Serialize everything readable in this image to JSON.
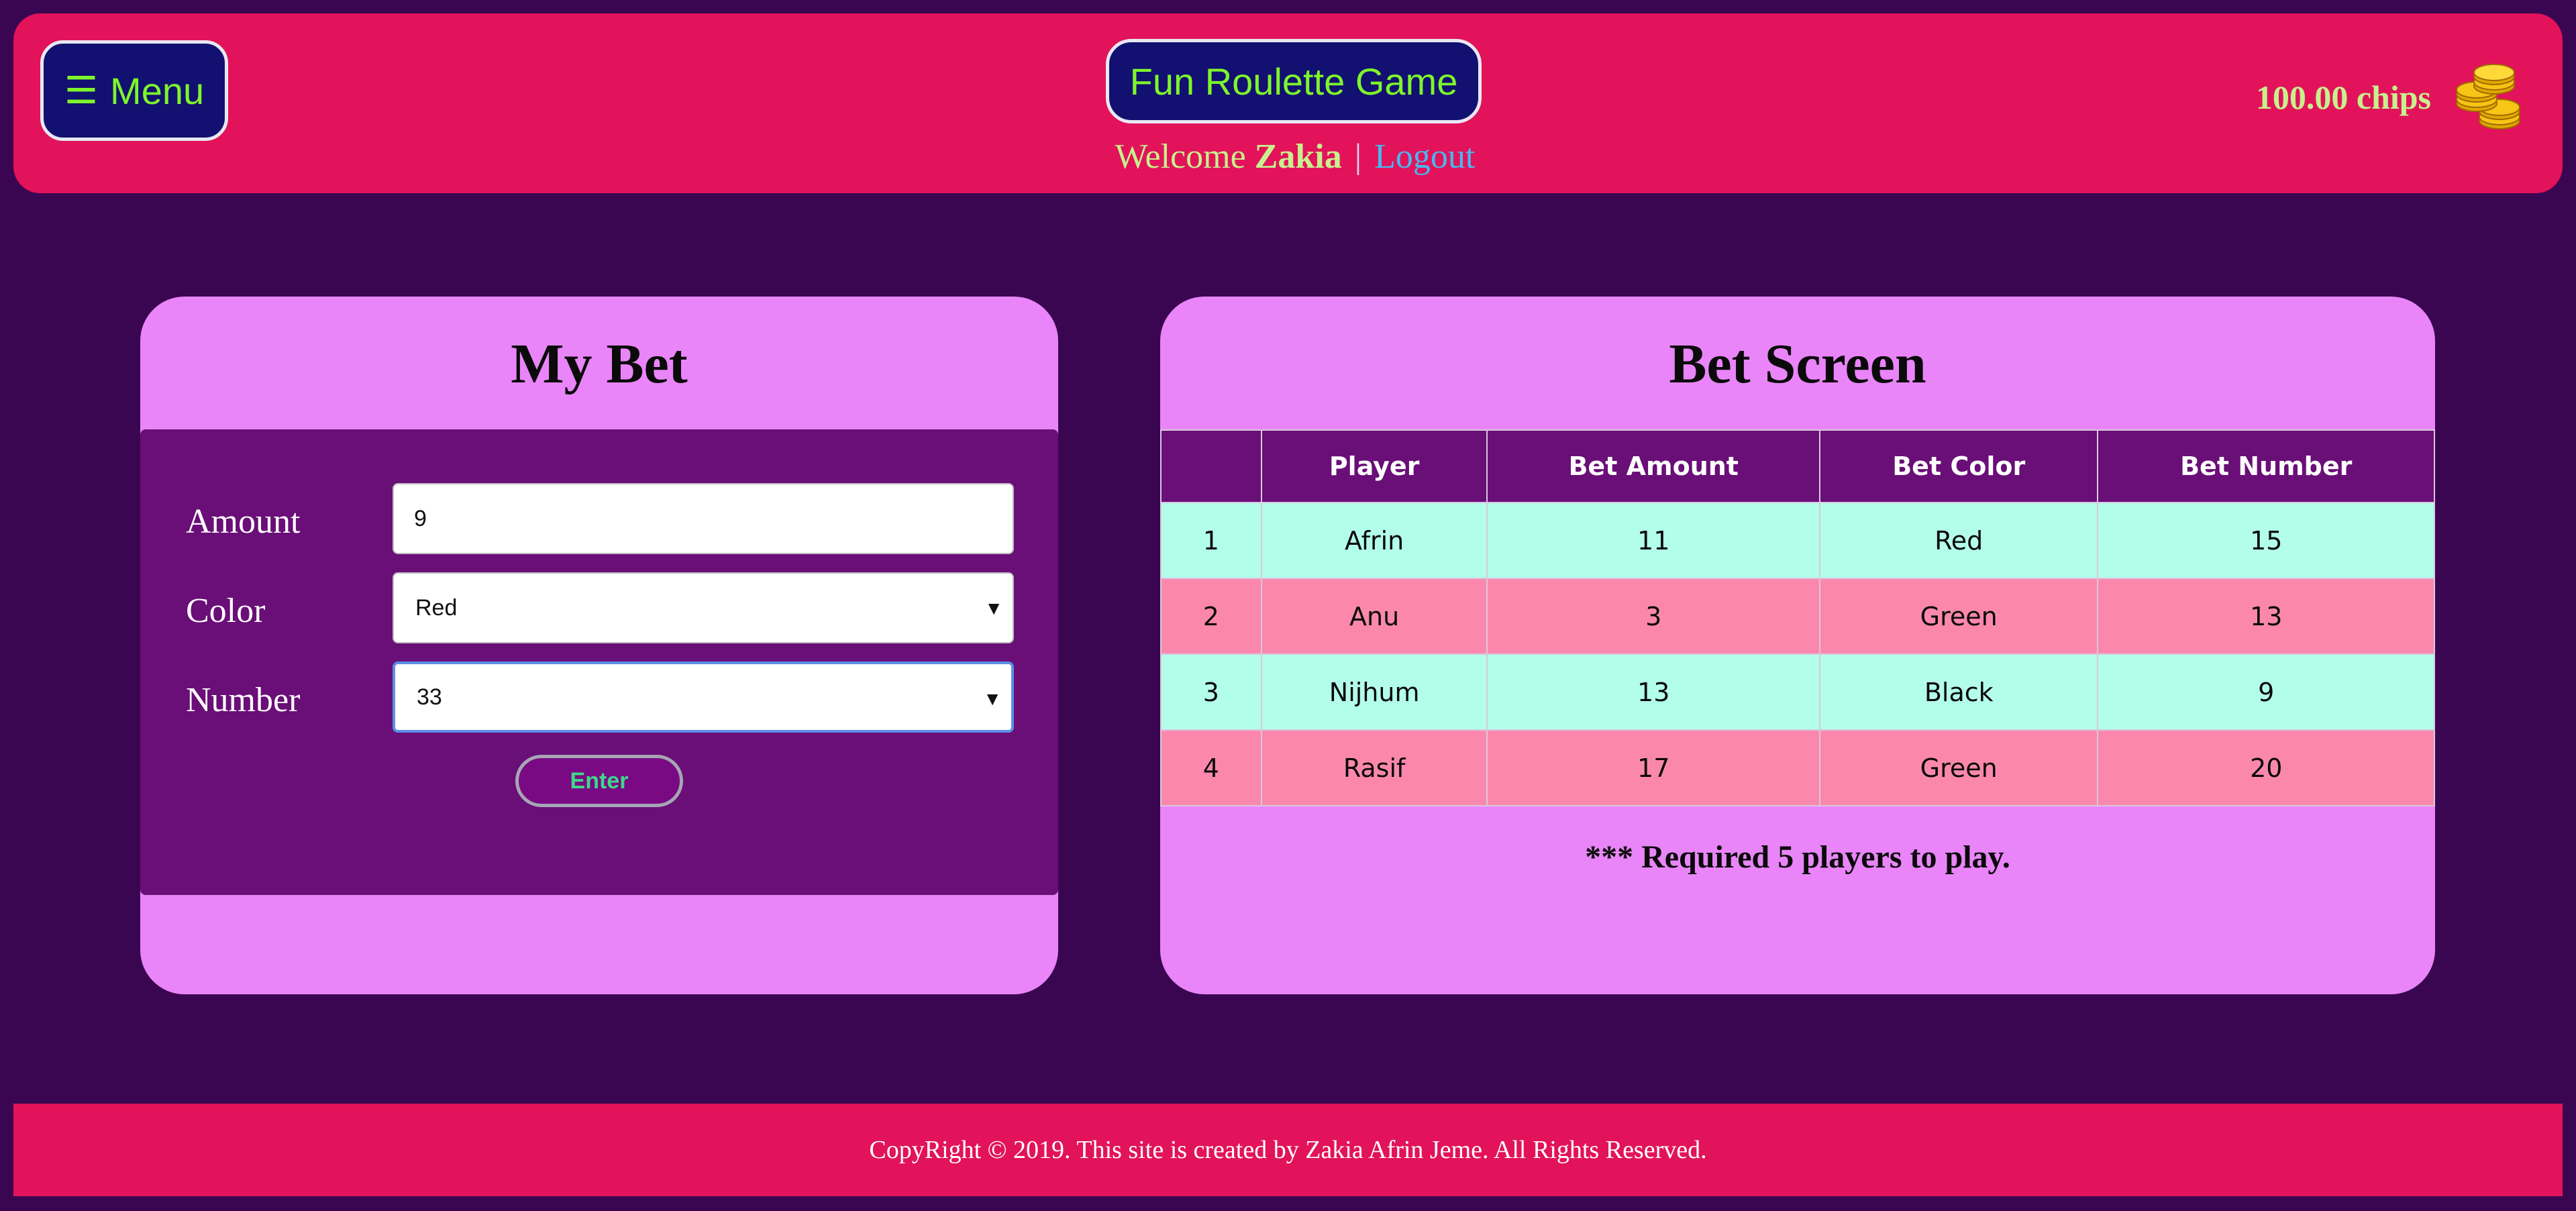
{
  "header": {
    "menu_label": "Menu",
    "title": "Fun Roulette Game",
    "welcome_prefix": "Welcome",
    "username": "Zakia",
    "separator": "|",
    "logout_label": "Logout",
    "chips": "100.00 chips"
  },
  "my_bet": {
    "title": "My Bet",
    "amount_label": "Amount",
    "amount_value": "9",
    "color_label": "Color",
    "color_value": "Red",
    "number_label": "Number",
    "number_value": "33",
    "enter_label": "Enter"
  },
  "bet_screen": {
    "title": "Bet Screen",
    "columns": [
      "",
      "Player",
      "Bet Amount",
      "Bet Color",
      "Bet Number"
    ],
    "rows": [
      {
        "idx": "1",
        "player": "Afrin",
        "amount": "11",
        "color": "Red",
        "number": "15"
      },
      {
        "idx": "2",
        "player": "Anu",
        "amount": "3",
        "color": "Green",
        "number": "13"
      },
      {
        "idx": "3",
        "player": "Nijhum",
        "amount": "13",
        "color": "Black",
        "number": "9"
      },
      {
        "idx": "4",
        "player": "Rasif",
        "amount": "17",
        "color": "Green",
        "number": "20"
      }
    ],
    "note": "*** Required 5 players to play."
  },
  "footer": {
    "text": "CopyRight © 2019. This site is created by Zakia Afrin Jeme. All Rights Reserved."
  },
  "colors": {
    "page_bg": "#3a0651",
    "header_bg": "#e2135a",
    "panel_bg": "#e985f8",
    "form_bg": "#6a0e78",
    "row_mint": "#b3fdeb",
    "row_pink": "#fb88ac",
    "accent_green": "#7ef52b",
    "logout_blue": "#48b8f0"
  },
  "icons": {
    "menu": "hamburger-icon",
    "chips": "gold-coins-icon",
    "select_caret": "caret-down-icon"
  }
}
